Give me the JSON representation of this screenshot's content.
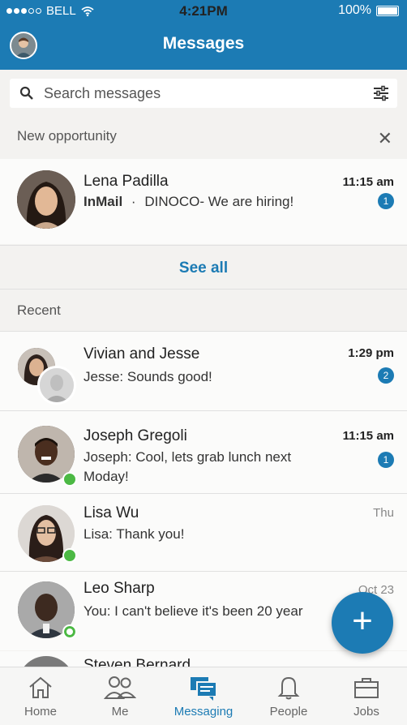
{
  "status_bar": {
    "carrier": "BELL",
    "time": "4:21PM",
    "battery": "100%"
  },
  "header": {
    "title": "Messages"
  },
  "search": {
    "placeholder": "Search messages"
  },
  "new_opportunity": {
    "label": "New opportunity",
    "item": {
      "name": "Lena Padilla",
      "time": "11:15 am",
      "tag": "InMail",
      "separator": "·",
      "message": "DINOCO- We are hiring!",
      "badge": "1"
    },
    "see_all": "See all"
  },
  "recent": {
    "label": "Recent",
    "items": [
      {
        "name": "Vivian and Jesse",
        "time": "1:29 pm",
        "message": "Jesse: Sounds good!",
        "badge": "2"
      },
      {
        "name": "Joseph Gregoli",
        "time": "11:15 am",
        "message_line1": "Joseph: Cool, lets grab lunch next",
        "message_line2": "Moday!",
        "badge": "1"
      },
      {
        "name": "Lisa Wu",
        "time": "Thu",
        "message": "Lisa: Thank you!"
      },
      {
        "name": "Leo Sharp",
        "time": "Oct 23",
        "message": "You: I can't believe it's been 20 year"
      },
      {
        "name": "Steven Bernard"
      }
    ]
  },
  "tabs": [
    {
      "label": "Home"
    },
    {
      "label": "Me"
    },
    {
      "label": "Messaging"
    },
    {
      "label": "People"
    },
    {
      "label": "Jobs"
    }
  ],
  "colors": {
    "brand": "#1c7bb4",
    "online": "#4cb944"
  }
}
